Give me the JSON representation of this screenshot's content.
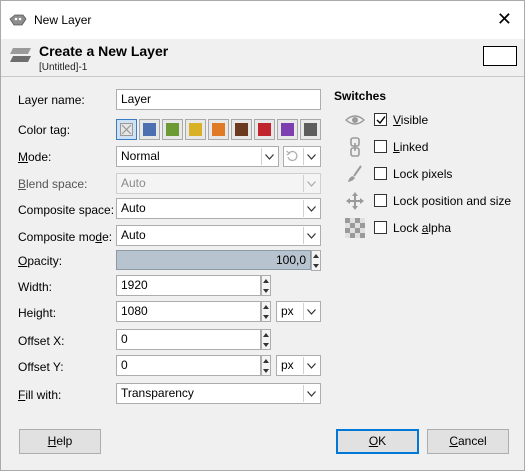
{
  "window": {
    "title": "New Layer",
    "close_glyph": "✕"
  },
  "header": {
    "title": "Create a New Layer",
    "subtitle": "[Untitled]-1"
  },
  "form": {
    "layer_name_label": "Layer name:",
    "layer_name_value": "Layer",
    "color_tag_label": "Color tag:",
    "color_tags": [
      {
        "name": "none",
        "color": "#d0d0d0"
      },
      {
        "name": "blue",
        "color": "#4e6fb0"
      },
      {
        "name": "green",
        "color": "#6d9a34"
      },
      {
        "name": "yellow",
        "color": "#d9b126"
      },
      {
        "name": "orange",
        "color": "#e07a26"
      },
      {
        "name": "brown",
        "color": "#6b3a1e"
      },
      {
        "name": "red",
        "color": "#c0252d"
      },
      {
        "name": "violet",
        "color": "#7d3fb0"
      },
      {
        "name": "gray",
        "color": "#5c5c5c"
      }
    ],
    "mode_label_u": "M",
    "mode_label_rest": "ode:",
    "mode_value": "Normal",
    "blend_space_label_u": "B",
    "blend_space_label_rest": "lend space:",
    "blend_space_value": "Auto",
    "composite_space_label": "Composite space:",
    "composite_space_value": "Auto",
    "composite_mode_label_pre": "Composite mo",
    "composite_mode_label_u": "d",
    "composite_mode_label_rest": "e:",
    "composite_mode_value": "Auto",
    "opacity_label_u": "O",
    "opacity_label_rest": "pacity:",
    "opacity_value": "100,0",
    "width_label": "Width:",
    "width_value": "1920",
    "height_label": "Height:",
    "height_value": "1080",
    "unit_value": "px",
    "offset_x_label": "Offset X:",
    "offset_x_value": "0",
    "offset_y_label": "Offset Y:",
    "offset_y_value": "0",
    "offset_unit_value": "px",
    "fill_label_u": "F",
    "fill_label_rest": "ill with:",
    "fill_value": "Transparency"
  },
  "switches": {
    "title": "Switches",
    "visible_u": "V",
    "visible_rest": "isible",
    "visible_checked": true,
    "linked_u": "L",
    "linked_rest": "inked",
    "linked_checked": false,
    "lock_pixels": "Lock pixels",
    "lock_pixels_checked": false,
    "lock_position": "Lock position and size",
    "lock_position_checked": false,
    "lock_alpha_pre": "Lock ",
    "lock_alpha_u": "a",
    "lock_alpha_rest": "lpha",
    "lock_alpha_checked": false
  },
  "buttons": {
    "help_u": "H",
    "help_rest": "elp",
    "ok_u": "O",
    "ok_rest": "K",
    "cancel_u": "C",
    "cancel_rest": "ancel"
  }
}
